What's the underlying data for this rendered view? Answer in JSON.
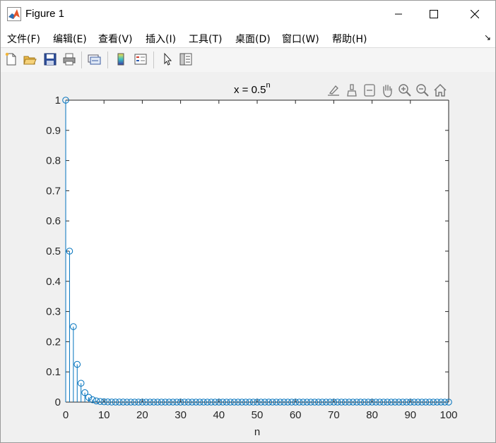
{
  "window": {
    "title": "Figure 1",
    "app_icon": "matlab-icon",
    "controls": [
      "minimize-icon",
      "maximize-icon",
      "close-icon"
    ]
  },
  "menubar": {
    "items": [
      "文件(F)",
      "编辑(E)",
      "查看(V)",
      "插入(I)",
      "工具(T)",
      "桌面(D)",
      "窗口(W)",
      "帮助(H)"
    ],
    "overflow_icon": "menu-overflow-arrow-icon",
    "overflow_glyph": "↘"
  },
  "toolbar": {
    "buttons": [
      "new-figure-icon",
      "open-file-icon",
      "save-icon",
      "print-icon",
      "link-plot-icon",
      "insert-colorbar-icon",
      "insert-legend-icon",
      "edit-plot-icon",
      "property-editor-icon"
    ]
  },
  "axes_toolbar": {
    "buttons": [
      "export-icon",
      "brush-icon",
      "data-tips-icon",
      "pan-icon",
      "zoom-in-icon",
      "zoom-out-icon",
      "home-icon"
    ]
  },
  "chart_data": {
    "type": "stem",
    "title": "x = 0.5",
    "title_superscript": "n",
    "xlabel": "n",
    "ylabel": "",
    "xlim": [
      0,
      100
    ],
    "ylim": [
      0,
      1
    ],
    "xticks": [
      0,
      10,
      20,
      30,
      40,
      50,
      60,
      70,
      80,
      90,
      100
    ],
    "yticks": [
      0,
      0.1,
      0.2,
      0.3,
      0.4,
      0.5,
      0.6,
      0.7,
      0.8,
      0.9,
      1
    ],
    "x_values": "0..100 step 1",
    "y_values": "0.5^n",
    "series": [
      {
        "name": "",
        "formula": "0.5^n",
        "color": "#0072bd",
        "marker": "circle"
      }
    ],
    "grid": false,
    "box": true
  }
}
